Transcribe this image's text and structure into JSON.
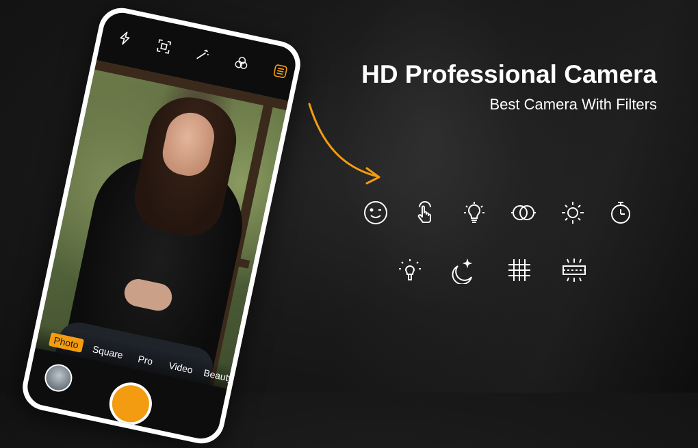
{
  "headline": {
    "title": "HD Professional Camera",
    "subtitle": "Best Camera With Filters"
  },
  "camera": {
    "top_icons": [
      "flash-icon",
      "scan-icon",
      "magic-wand-icon",
      "filters-icon",
      "menu-icon"
    ],
    "modes": {
      "photo": "Photo",
      "square": "Square",
      "pro": "Pro",
      "video": "Video",
      "beauty": "Beauty"
    },
    "active_mode": "Photo"
  },
  "features": {
    "row1": [
      "smile-icon",
      "touch-icon",
      "bulb-icon",
      "overlay-icon",
      "brightness-icon",
      "timer-icon"
    ],
    "row2": [
      "light-icon",
      "night-icon",
      "grid-icon",
      "level-icon"
    ]
  },
  "colors": {
    "accent": "#f39c12",
    "background": "#1a1a1a",
    "text": "#ffffff"
  }
}
